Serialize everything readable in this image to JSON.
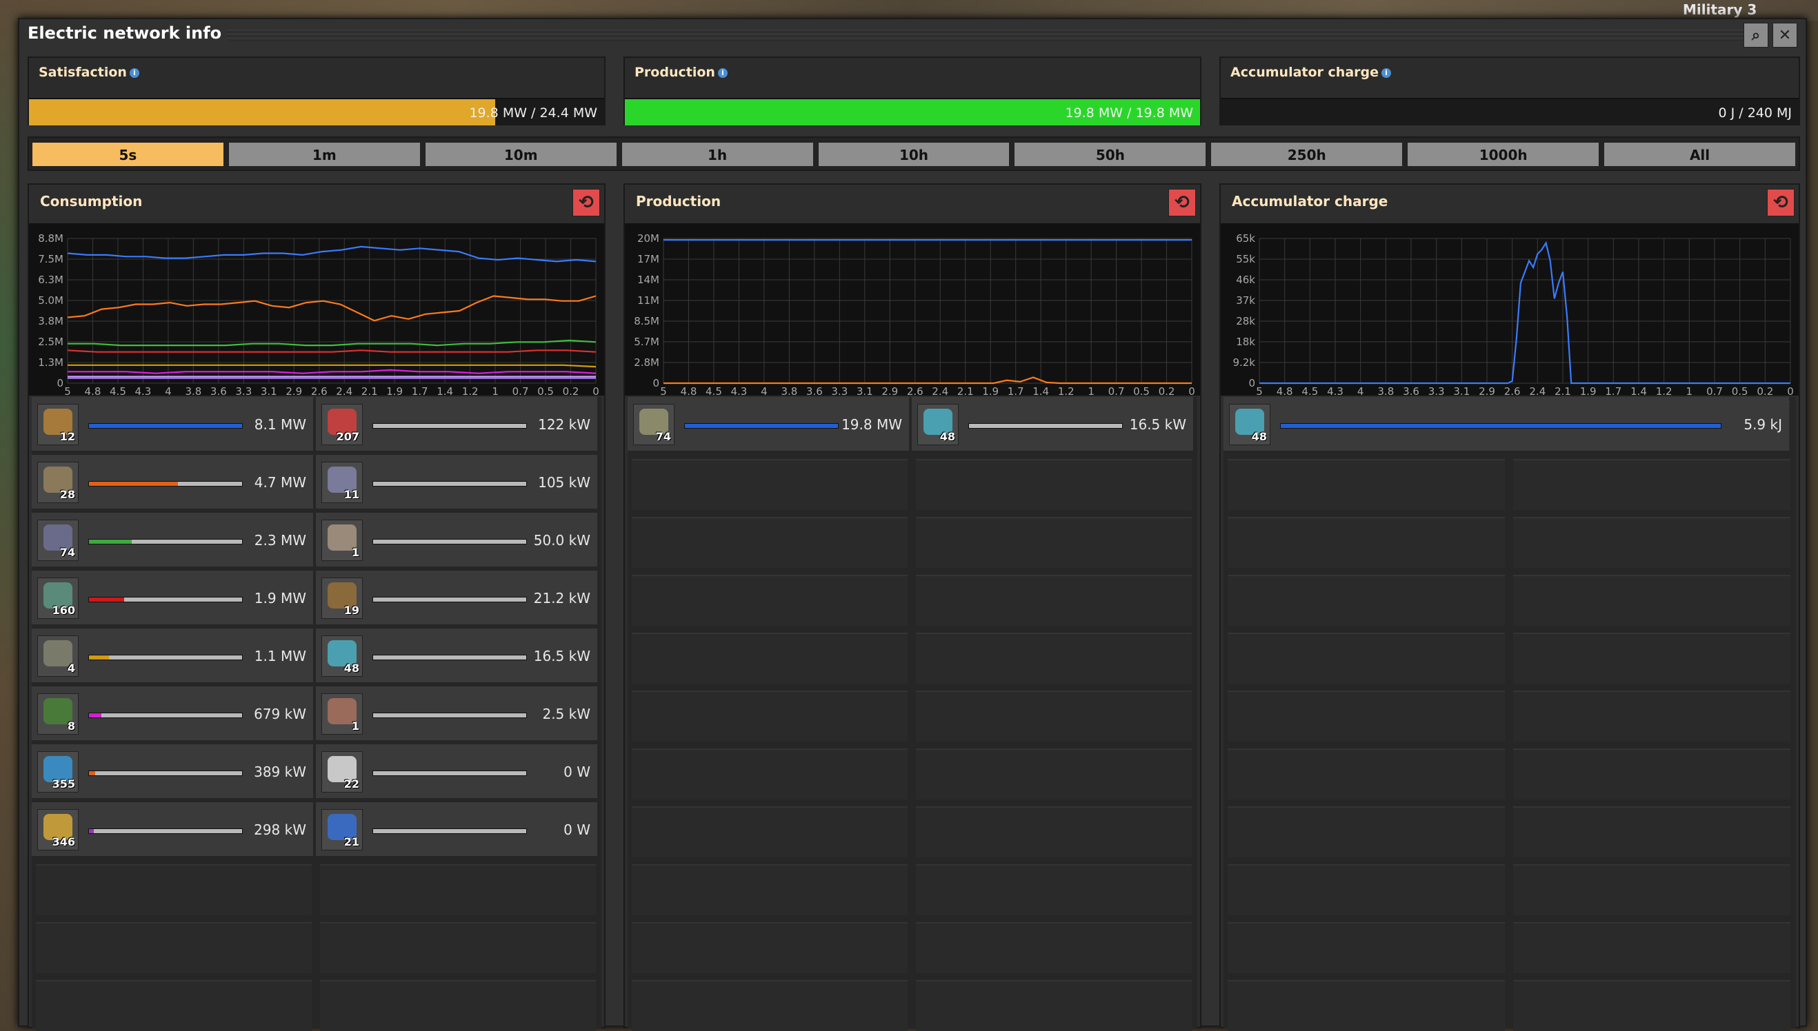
{
  "window": {
    "title": "Electric network info",
    "external_label": "Military 3"
  },
  "stats": [
    {
      "label": "Satisfaction",
      "value": "19.8 MW / 24.4 MW",
      "fill": 0.81,
      "color": "#e0a72a"
    },
    {
      "label": "Production",
      "value": "19.8 MW / 19.8 MW",
      "fill": 1.0,
      "color": "#2bd62b"
    },
    {
      "label": "Accumulator charge",
      "value": "0 J / 240 MJ",
      "fill": 0.0,
      "color": "#2bd62b"
    }
  ],
  "time_buttons": [
    "5s",
    "1m",
    "10m",
    "1h",
    "10h",
    "50h",
    "250h",
    "1000h",
    "All"
  ],
  "selected_time": "5s",
  "sections": [
    {
      "title": "Consumption"
    },
    {
      "title": "Production"
    },
    {
      "title": "Accumulator charge"
    }
  ],
  "chart_data": [
    {
      "type": "line",
      "title": "Consumption",
      "x_ticks": [
        "5",
        "4.8",
        "4.5",
        "4.3",
        "4",
        "3.8",
        "3.6",
        "3.3",
        "3.1",
        "2.9",
        "2.6",
        "2.4",
        "2.1",
        "1.9",
        "1.7",
        "1.4",
        "1.2",
        "1",
        "0.7",
        "0.5",
        "0.2",
        "0"
      ],
      "y_ticks": [
        "0",
        "1.3M",
        "2.5M",
        "3.8M",
        "5.0M",
        "6.3M",
        "7.5M",
        "8.8M"
      ],
      "ylim": [
        0,
        8.8
      ],
      "x_range": [
        5,
        0
      ],
      "series": [
        {
          "color": "#3a7bff",
          "values": [
            7.9,
            7.8,
            7.8,
            7.7,
            7.7,
            7.6,
            7.6,
            7.7,
            7.8,
            7.8,
            7.9,
            7.9,
            7.8,
            8.0,
            8.1,
            8.3,
            8.2,
            8.1,
            8.2,
            8.1,
            8.0,
            7.6,
            7.5,
            7.6,
            7.5,
            7.4,
            7.5,
            7.4
          ]
        },
        {
          "color": "#ff7a1a",
          "values": [
            4.0,
            4.1,
            4.5,
            4.6,
            4.8,
            4.8,
            4.9,
            4.7,
            4.8,
            4.8,
            4.9,
            5.0,
            4.7,
            4.6,
            4.9,
            5.0,
            4.8,
            4.3,
            3.8,
            4.1,
            3.9,
            4.2,
            4.3,
            4.4,
            4.9,
            5.3,
            5.2,
            5.1,
            5.1,
            5.0,
            5.0,
            5.3
          ]
        },
        {
          "color": "#3fbf3f",
          "values": [
            2.4,
            2.4,
            2.3,
            2.3,
            2.3,
            2.3,
            2.3,
            2.4,
            2.4,
            2.3,
            2.3,
            2.4,
            2.4,
            2.4,
            2.3,
            2.4,
            2.4,
            2.5,
            2.5,
            2.6,
            2.5
          ]
        },
        {
          "color": "#e03030",
          "values": [
            2.0,
            1.9,
            1.9,
            1.9,
            1.9,
            1.9,
            1.9,
            1.9,
            1.9,
            1.9,
            2.0,
            1.9,
            1.9,
            1.9,
            1.9,
            1.9,
            2.0,
            2.0,
            1.9
          ]
        },
        {
          "color": "#d6a000",
          "values": [
            1.1,
            1.1,
            1.1,
            1.1,
            1.1,
            1.1,
            1.1,
            1.1,
            1.1,
            1.1,
            1.1,
            1.1,
            1.1,
            1.1,
            1.1,
            1.1,
            1.0
          ]
        },
        {
          "color": "#e020e0",
          "values": [
            0.7,
            0.7,
            0.7,
            0.6,
            0.7,
            0.7,
            0.7,
            0.7,
            0.6,
            0.7,
            0.7,
            0.8,
            0.7,
            0.7,
            0.6,
            0.7,
            0.7,
            0.7,
            0.6
          ]
        },
        {
          "color": "#c8a0ff",
          "values": [
            0.4,
            0.4,
            0.4,
            0.4,
            0.4,
            0.4,
            0.4,
            0.4,
            0.4,
            0.4,
            0.4,
            0.4,
            0.4,
            0.4,
            0.4,
            0.4
          ]
        },
        {
          "color": "#a070e0",
          "values": [
            0.3,
            0.3,
            0.3,
            0.3,
            0.3,
            0.3,
            0.3,
            0.3,
            0.3,
            0.3,
            0.3,
            0.3,
            0.3,
            0.3,
            0.3,
            0.3
          ]
        }
      ]
    },
    {
      "type": "line",
      "title": "Production",
      "x_ticks": [
        "5",
        "4.8",
        "4.5",
        "4.3",
        "4",
        "3.8",
        "3.6",
        "3.3",
        "3.1",
        "2.9",
        "2.6",
        "2.4",
        "2.1",
        "1.9",
        "1.7",
        "1.4",
        "1.2",
        "1",
        "0.7",
        "0.5",
        "0.2",
        "0"
      ],
      "y_ticks": [
        "0",
        "2.8M",
        "5.7M",
        "8.5M",
        "11M",
        "14M",
        "17M",
        "20M"
      ],
      "ylim": [
        0,
        20
      ],
      "x_range": [
        5,
        0
      ],
      "series": [
        {
          "color": "#3a7bff",
          "values": [
            19.8,
            19.8,
            19.8,
            19.8,
            19.8,
            19.8,
            19.8,
            19.8,
            19.8,
            19.8
          ]
        },
        {
          "color": "#ff7a1a",
          "values": [
            0,
            0,
            0,
            0,
            0,
            0,
            0,
            0,
            0,
            0,
            0,
            0,
            0,
            0,
            0,
            0,
            0,
            0,
            0,
            0,
            0,
            0,
            0,
            0,
            0,
            0,
            0.4,
            0.2,
            0.8,
            0.1,
            0,
            0,
            0,
            0,
            0,
            0,
            0,
            0,
            0,
            0,
            0
          ]
        }
      ]
    },
    {
      "type": "line",
      "title": "Accumulator charge",
      "x_ticks": [
        "5",
        "4.8",
        "4.5",
        "4.3",
        "4",
        "3.8",
        "3.6",
        "3.3",
        "3.1",
        "2.9",
        "2.6",
        "2.4",
        "2.1",
        "1.9",
        "1.7",
        "1.4",
        "1.2",
        "1",
        "0.7",
        "0.5",
        "0.2",
        "0"
      ],
      "y_ticks": [
        "0",
        "9.2k",
        "18k",
        "28k",
        "37k",
        "46k",
        "55k",
        "65k"
      ],
      "ylim": [
        0,
        65
      ],
      "x_range": [
        5,
        0
      ],
      "series": [
        {
          "color": "#3a7bff",
          "values": [
            0,
            0,
            0,
            0,
            0,
            0,
            0,
            0,
            0,
            0,
            0,
            0,
            0,
            0,
            0,
            0,
            0,
            0,
            0,
            0,
            0,
            0,
            0,
            0,
            0,
            0,
            0,
            0,
            0,
            0,
            0,
            0,
            0,
            0,
            0,
            0,
            0,
            0,
            0,
            0,
            0,
            0,
            0,
            0,
            0,
            0,
            0,
            0,
            0,
            0,
            0,
            0,
            0,
            0,
            0,
            0,
            0,
            0,
            0,
            0,
            1,
            20,
            45,
            50,
            55,
            52,
            58,
            60,
            63,
            55,
            38,
            45,
            50,
            30,
            0,
            0,
            0,
            0,
            0,
            0,
            0,
            0,
            0,
            0,
            0,
            0,
            0,
            0,
            0,
            0,
            0,
            0,
            0,
            0,
            0,
            0,
            0,
            0,
            0,
            0,
            0,
            0,
            0,
            0,
            0,
            0,
            0,
            0,
            0,
            0,
            0,
            0,
            0,
            0,
            0,
            0,
            0,
            0,
            0,
            0,
            0,
            0,
            0,
            0,
            0,
            0,
            0
          ]
        }
      ]
    }
  ],
  "consumption_rows": [
    {
      "count": "12",
      "value": "8.1 MW",
      "fill": 1.0,
      "color": "#1f5fd6",
      "icon": "assembler-icon"
    },
    {
      "count": "207",
      "value": "122 kW",
      "fill": 0.0,
      "color": "#1f5fd6",
      "icon": "inserter-icon"
    },
    {
      "count": "28",
      "value": "4.7 MW",
      "fill": 0.58,
      "color": "#e0601a",
      "icon": "furnace-icon"
    },
    {
      "count": "11",
      "value": "105 kW",
      "fill": 0.0,
      "color": "#1f5fd6",
      "icon": "lab-icon"
    },
    {
      "count": "74",
      "value": "2.3 MW",
      "fill": 0.28,
      "color": "#3fa83f",
      "icon": "miner-icon"
    },
    {
      "count": "1",
      "value": "50.0 kW",
      "fill": 0.0,
      "color": "#1f5fd6",
      "icon": "roboport-icon"
    },
    {
      "count": "160",
      "value": "1.9 MW",
      "fill": 0.23,
      "color": "#d01818",
      "icon": "turret-icon"
    },
    {
      "count": "19",
      "value": "21.2 kW",
      "fill": 0.0,
      "color": "#1f5fd6",
      "icon": "pump-icon"
    },
    {
      "count": "4",
      "value": "1.1 MW",
      "fill": 0.13,
      "color": "#d09a10",
      "icon": "refinery-icon"
    },
    {
      "count": "48",
      "value": "16.5 kW",
      "fill": 0.0,
      "color": "#1f5fd6",
      "icon": "accumulator-icon"
    },
    {
      "count": "8",
      "value": "679 kW",
      "fill": 0.08,
      "color": "#d020d0",
      "icon": "chem-plant-icon"
    },
    {
      "count": "1",
      "value": "2.5 kW",
      "fill": 0.0,
      "color": "#1f5fd6",
      "icon": "radar-icon"
    },
    {
      "count": "355",
      "value": "389 kW",
      "fill": 0.04,
      "color": "#e0601a",
      "icon": "belt-inserter-icon"
    },
    {
      "count": "22",
      "value": "0 W",
      "fill": 0.0,
      "color": "#1f5fd6",
      "icon": "lamp-icon"
    },
    {
      "count": "346",
      "value": "298 kW",
      "fill": 0.03,
      "color": "#a030c0",
      "icon": "long-inserter-icon"
    },
    {
      "count": "21",
      "value": "0 W",
      "fill": 0.0,
      "color": "#1f5fd6",
      "icon": "globe-icon"
    }
  ],
  "production_rows": [
    {
      "count": "74",
      "value": "19.8 MW",
      "fill": 1.0,
      "color": "#1f5fd6",
      "icon": "steam-engine-icon"
    },
    {
      "count": "48",
      "value": "16.5 kW",
      "fill": 0.0,
      "color": "#1f5fd6",
      "icon": "accumulator-icon"
    }
  ],
  "accumulator_rows": [
    {
      "count": "48",
      "value": "5.9 kJ",
      "fill": 1.0,
      "color": "#1f5fd6",
      "icon": "accumulator-icon"
    }
  ]
}
